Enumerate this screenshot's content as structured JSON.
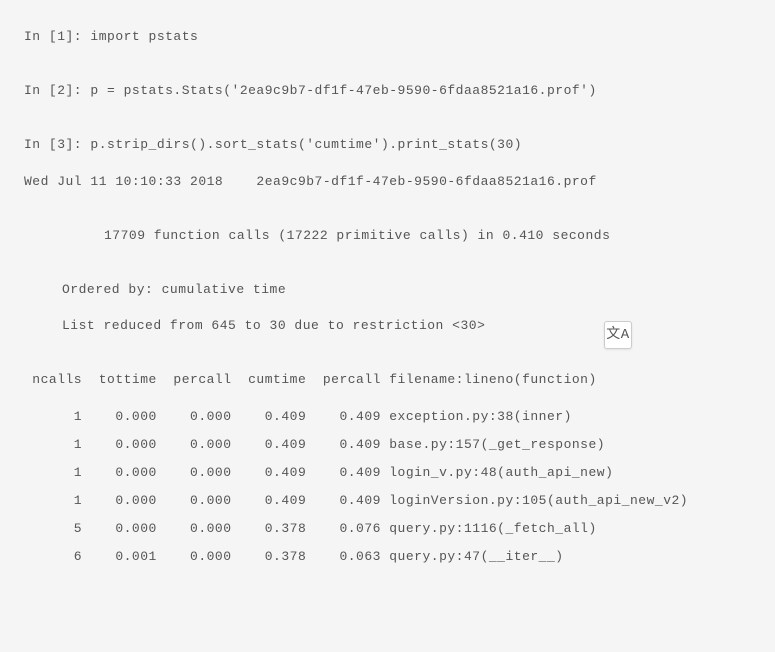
{
  "lines": {
    "in1": "In [1]: import pstats",
    "in2": "In [2]: p = pstats.Stats('2ea9c9b7-df1f-47eb-9590-6fdaa8521a16.prof')",
    "in3": "In [3]: p.strip_dirs().sort_stats('cumtime').print_stats(30)",
    "dateprof": "Wed Jul 11 10:10:33 2018    2ea9c9b7-df1f-47eb-9590-6fdaa8521a16.prof",
    "summary": "17709 function calls (17222 primitive calls) in 0.410 seconds",
    "ordered": "Ordered by: cumulative time",
    "reduced": "List reduced from 645 to 30 due to restriction <30>"
  },
  "translate_glyph": "文A",
  "stats": {
    "header": " ncalls  tottime  percall  cumtime  percall filename:lineno(function)",
    "rows": [
      "      1    0.000    0.000    0.409    0.409 exception.py:38(inner)",
      "      1    0.000    0.000    0.409    0.409 base.py:157(_get_response)",
      "      1    0.000    0.000    0.409    0.409 login_v.py:48(auth_api_new)",
      "      1    0.000    0.000    0.409    0.409 loginVersion.py:105(auth_api_new_v2)",
      "      5    0.000    0.000    0.378    0.076 query.py:1116(_fetch_all)",
      "      6    0.001    0.000    0.378    0.063 query.py:47(__iter__)"
    ]
  },
  "chart_data": {
    "type": "table",
    "title": "pstats cumulative time output",
    "columns": [
      "ncalls",
      "tottime",
      "percall",
      "cumtime",
      "percall",
      "filename:lineno(function)"
    ],
    "rows": [
      [
        1,
        0.0,
        0.0,
        0.409,
        0.409,
        "exception.py:38(inner)"
      ],
      [
        1,
        0.0,
        0.0,
        0.409,
        0.409,
        "base.py:157(_get_response)"
      ],
      [
        1,
        0.0,
        0.0,
        0.409,
        0.409,
        "login_v.py:48(auth_api_new)"
      ],
      [
        1,
        0.0,
        0.0,
        0.409,
        0.409,
        "loginVersion.py:105(auth_api_new_v2)"
      ],
      [
        5,
        0.0,
        0.0,
        0.378,
        0.076,
        "query.py:1116(_fetch_all)"
      ],
      [
        6,
        0.001,
        0.0,
        0.378,
        0.063,
        "query.py:47(__iter__)"
      ]
    ]
  }
}
